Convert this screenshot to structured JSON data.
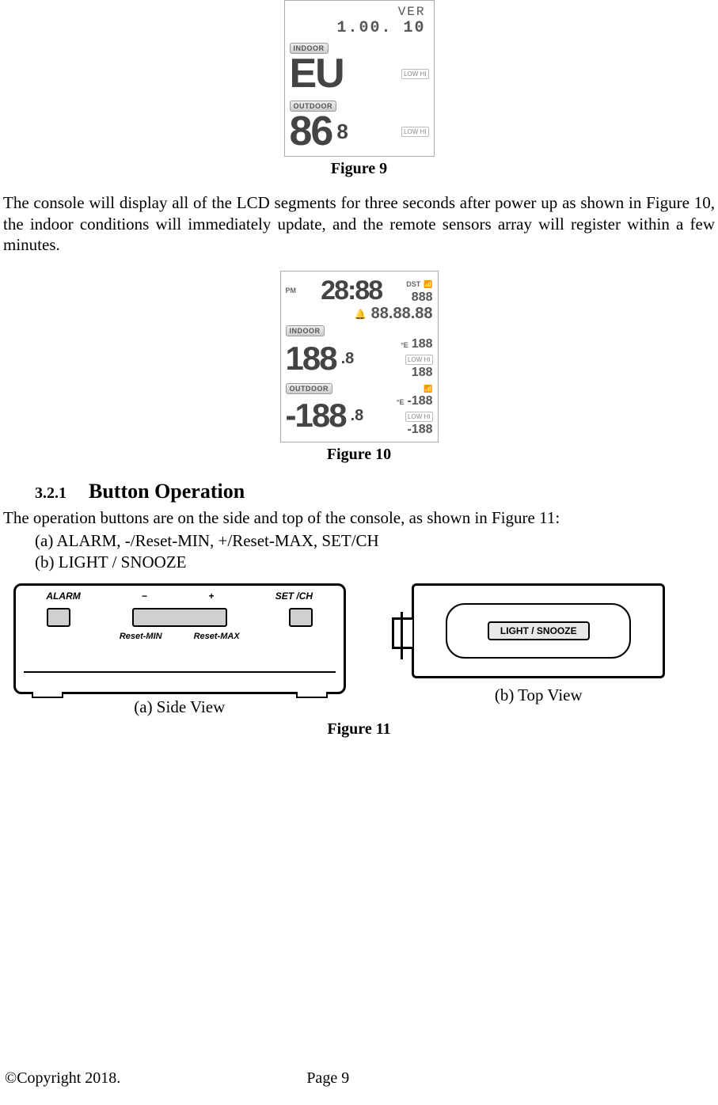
{
  "figure9": {
    "caption": "Figure 9",
    "lcd": {
      "line1": "VER",
      "line2": "1.00. 10",
      "indoorLabel": "INDOOR",
      "indoorBig": "EU",
      "lowhi1": "LOW HI",
      "outdoorLabel": "OUTDOOR",
      "outdoorBig": "86",
      "outdoorSmall": "8",
      "lowhi2": "LOW HI"
    }
  },
  "para1": "The console will display all of the LCD segments for three seconds after power up as shown in Figure 10, the indoor conditions will immediately update, and the remote sensors array will register within a few minutes.",
  "figure10": {
    "caption": "Figure 10",
    "lcd": {
      "pm": "PM",
      "timeBig": "28:88",
      "dst": "DST",
      "dateTop": "888",
      "dateBot": "88.88.88",
      "indoorLabel": "INDOOR",
      "indoorBig": "188",
      "indoorSmall": ".8",
      "indoorUnit": "°E",
      "indoorMini1": "188",
      "indoorMini2": "188",
      "lowhi": "LOW HI",
      "outdoorLabel": "OUTDOOR",
      "outdoorBig": "-188",
      "outdoorSmall": ".8",
      "outdoorUnit": "°E",
      "outdoorMini1": "-188",
      "outdoorMini2": "-188"
    }
  },
  "section": {
    "number": "3.2.1",
    "title": "Button Operation"
  },
  "opIntro": "The operation buttons are on the side and top of the console, as shown in Figure 11:",
  "opList": {
    "a": "(a)  ALARM, -/Reset-MIN, +/Reset-MAX, SET/CH",
    "b": "(b)  LIGHT / SNOOZE"
  },
  "figure11": {
    "caption": "Figure 11",
    "sideView": {
      "caption": "(a)  Side View",
      "labelAlarm": "ALARM",
      "labelMinus": "−",
      "labelPlus": "+",
      "labelSet": "SET /CH",
      "labelResetMin": "Reset-MIN",
      "labelResetMax": "Reset-MAX"
    },
    "topView": {
      "caption": "(b)  Top View",
      "labelSnooze": "LIGHT / SNOOZE"
    }
  },
  "footer": {
    "copyright": "©Copyright 2018.",
    "page": "Page 9"
  }
}
